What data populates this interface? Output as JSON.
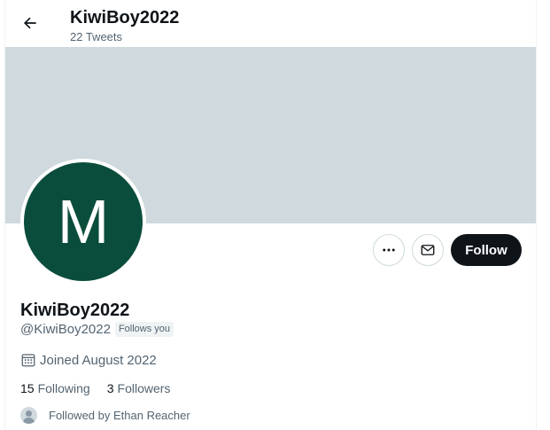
{
  "header": {
    "title": "KiwiBoy2022",
    "tweet_count": "22 Tweets"
  },
  "profile": {
    "avatar_letter": "M",
    "avatar_color": "#0b4d3c",
    "banner_color": "#cfd9de",
    "display_name": "KiwiBoy2022",
    "handle": "@KiwiBoy2022",
    "follows_you_badge": "Follows you",
    "joined": "Joined August 2022",
    "following_count": "15",
    "following_label": "Following",
    "followers_count": "3",
    "followers_label": "Followers",
    "followed_by": "Followed by Ethan Reacher"
  },
  "actions": {
    "more_icon": "more-horizontal-icon",
    "message_icon": "envelope-icon",
    "follow_label": "Follow"
  }
}
